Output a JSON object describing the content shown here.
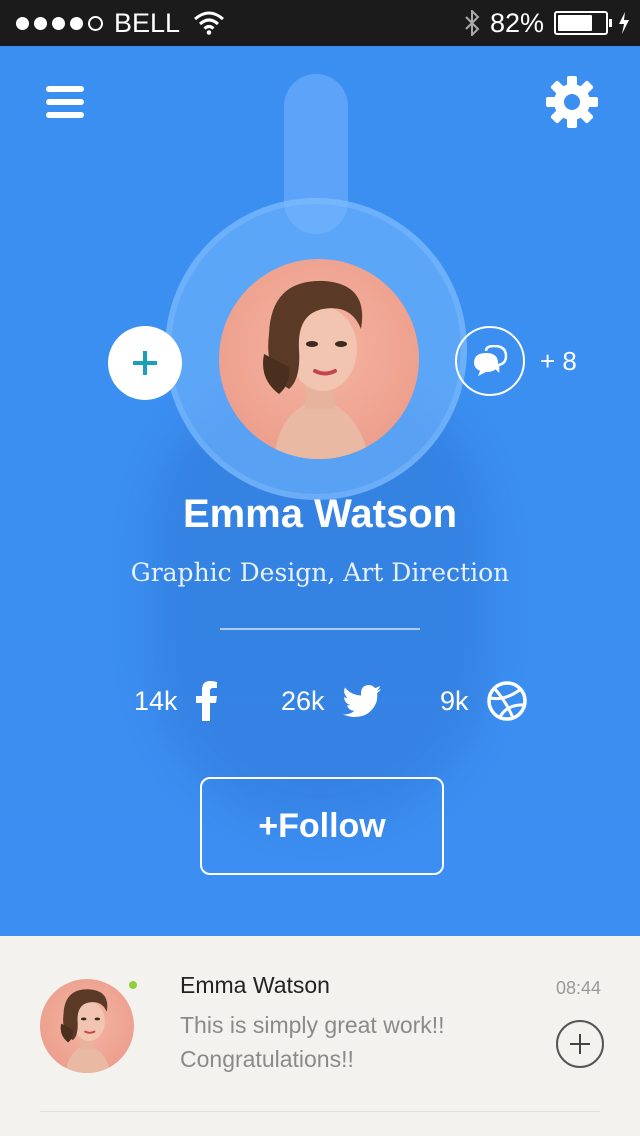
{
  "status_bar": {
    "carrier": "BELL",
    "battery_percent": "82%",
    "battery_level": 0.82,
    "signal_dots_filled": 4,
    "signal_dots_total": 5
  },
  "profile": {
    "name": "Emma Watson",
    "role": "Graphic Design, Art Direction",
    "extra_count": "+ 8"
  },
  "stats": [
    {
      "value": "14k",
      "network": "facebook"
    },
    {
      "value": "26k",
      "network": "twitter"
    },
    {
      "value": "9k",
      "network": "dribbble"
    }
  ],
  "follow_button": {
    "label": "+Follow"
  },
  "comment": {
    "author": "Emma Watson",
    "time": "08:44",
    "text": "This is simply great work!! Congratulations!!"
  },
  "icons": {
    "menu": "menu-icon",
    "settings": "gear-icon",
    "add": "plus-icon",
    "chat": "chat-bubbles-icon",
    "facebook": "facebook-icon",
    "twitter": "twitter-icon",
    "dribbble": "dribbble-icon",
    "bluetooth": "bluetooth-icon",
    "wifi": "wifi-icon",
    "charging": "bolt-icon"
  },
  "colors": {
    "accent": "#3a8ff1",
    "status_bar": "#1b1b1b",
    "plus_icon": "#1aa1b7",
    "online": "#8fcf3c",
    "comment_bg": "#f4f2ee"
  }
}
